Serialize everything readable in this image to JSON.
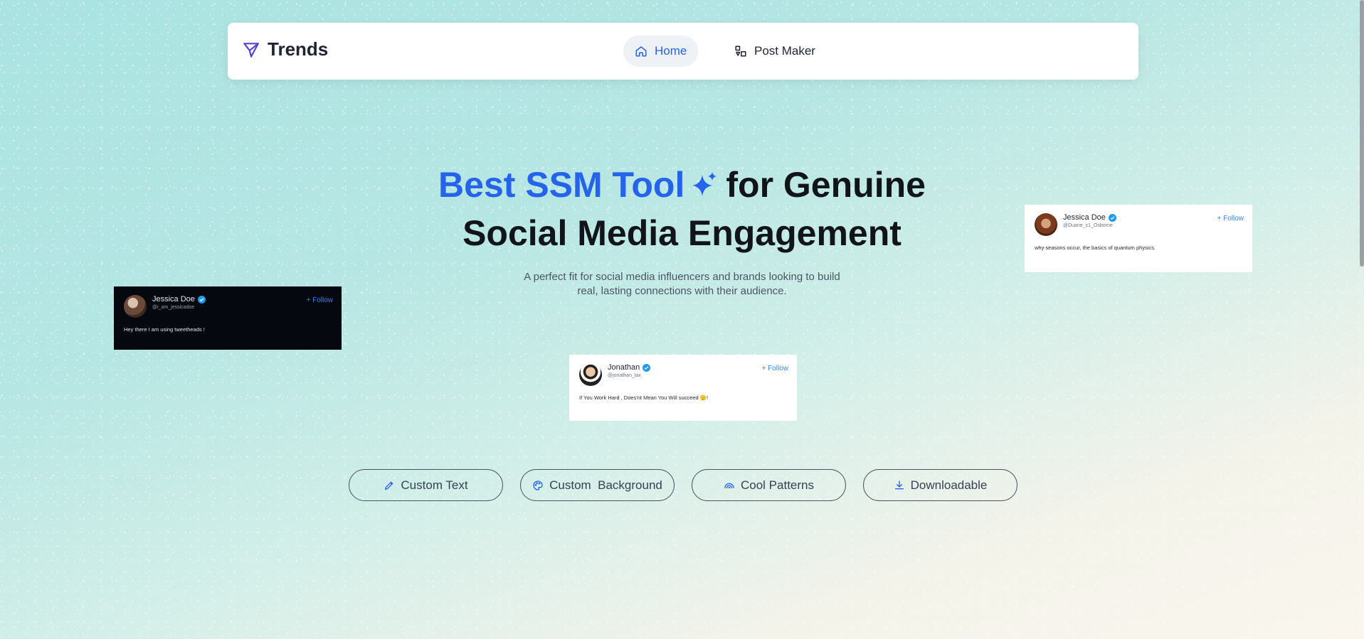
{
  "nav": {
    "brand": "Trends",
    "links": [
      {
        "label": "Home",
        "icon": "home-icon",
        "active": true
      },
      {
        "label": "Post Maker",
        "icon": "shapes-icon",
        "active": false
      }
    ]
  },
  "hero": {
    "accent": "Best SSM Tool",
    "title_rest": "for Genuine",
    "title_line2": "Social Media Engagement",
    "subtitle_line1": "A perfect fit for social media influencers and brands looking to build",
    "subtitle_line2": "real, lasting connections with their audience."
  },
  "cards": [
    {
      "name": "Jessica Doe",
      "handle": "@i_am_jessicadoe",
      "follow": "+ Follow",
      "text": "Hey there I am using tweetheads !",
      "theme": "dark"
    },
    {
      "name": "Jonathan",
      "handle": "@jonathan_lax",
      "follow": "+ Follow",
      "text": "If You Work Hard , Does'nt Mean You Will succeed 🫡!",
      "theme": "light"
    },
    {
      "name": "Jessica Doe",
      "handle": "@Duane_c1_Osborne",
      "follow": "+ Follow",
      "text": "why seasons occur, the basics of quantum physics.",
      "theme": "light"
    }
  ],
  "features": [
    {
      "label": "Custom Text",
      "icon": "pencil-icon"
    },
    {
      "label": "Custom  Background",
      "icon": "palette-icon"
    },
    {
      "label": "Cool Patterns",
      "icon": "rainbow-icon"
    },
    {
      "label": "Downloadable",
      "icon": "download-icon"
    }
  ],
  "colors": {
    "accent": "#2563eb",
    "verified": "#1d9bf0"
  }
}
